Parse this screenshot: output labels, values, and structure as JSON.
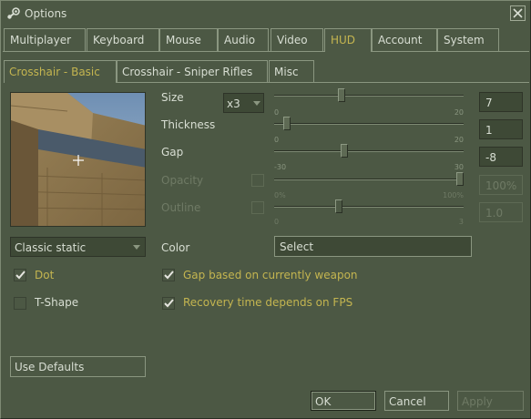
{
  "window": {
    "title": "Options",
    "icon": "steam-icon",
    "close_icon": "close-icon"
  },
  "tabs": [
    {
      "label": "Multiplayer",
      "active": false
    },
    {
      "label": "Keyboard",
      "active": false
    },
    {
      "label": "Mouse",
      "active": false
    },
    {
      "label": "Audio",
      "active": false
    },
    {
      "label": "Video",
      "active": false
    },
    {
      "label": "HUD",
      "active": true
    },
    {
      "label": "Account",
      "active": false
    },
    {
      "label": "System",
      "active": false
    }
  ],
  "subtabs": [
    {
      "label": "Crosshair - Basic",
      "active": true
    },
    {
      "label": "Crosshair - Sniper Rifles",
      "active": false
    },
    {
      "label": "Misc",
      "active": false
    }
  ],
  "crosshair_style": "Classic static",
  "sliders": {
    "size": {
      "label": "Size",
      "min_label": "0",
      "max_label": "20",
      "value": 7,
      "value_text": "7",
      "multiplier": "x3",
      "enabled": true
    },
    "thickness": {
      "label": "Thickness",
      "min_label": "0",
      "max_label": "20",
      "value": 1,
      "value_text": "1",
      "enabled": true
    },
    "gap": {
      "label": "Gap",
      "min_label": "-30",
      "max_label": "30",
      "value": -8,
      "value_text": "-8",
      "enabled": true
    },
    "opacity": {
      "label": "Opacity",
      "min_label": "0%",
      "max_label": "100%",
      "value": 100,
      "value_text": "100%",
      "enabled": false
    },
    "outline": {
      "label": "Outline",
      "min_label": "0",
      "max_label": "3",
      "value": 1,
      "value_text": "1.0",
      "enabled": false
    }
  },
  "color": {
    "label": "Color",
    "button_label": "Select"
  },
  "checkboxes": {
    "dot": {
      "label": "Dot",
      "checked": true
    },
    "t_shape": {
      "label": "T-Shape",
      "checked": false
    },
    "gap_weapon": {
      "label": "Gap based on currently weapon",
      "checked": true
    },
    "recovery_fps": {
      "label": "Recovery time depends on FPS",
      "checked": true
    }
  },
  "buttons": {
    "use_defaults": "Use Defaults",
    "ok": "OK",
    "cancel": "Cancel",
    "apply": "Apply"
  },
  "colors": {
    "background": "#4c5844",
    "accent_text": "#c4b550",
    "disabled_text": "#6f7a65"
  }
}
